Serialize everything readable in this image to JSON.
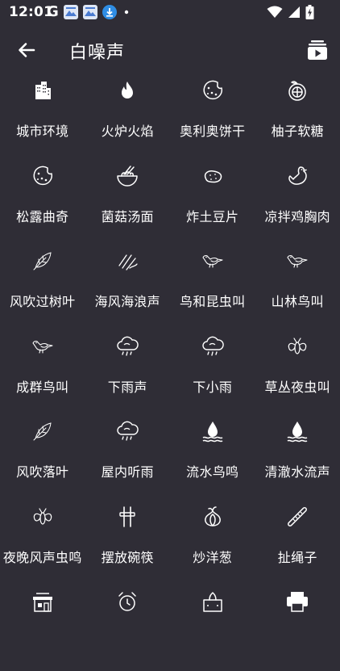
{
  "status_bar": {
    "time": "12:01",
    "g_label": "G",
    "icons": [
      "google-icon",
      "app-notification-icon",
      "app-notification-icon",
      "download-icon",
      "dot-icon",
      "wifi-icon",
      "signal-icon",
      "battery-charging-icon"
    ]
  },
  "header": {
    "title": "白噪声",
    "back_icon": "arrow-left-icon",
    "playlist_icon": "playlist-play-icon"
  },
  "sounds": [
    {
      "label": "城市环境",
      "icon": "city-icon"
    },
    {
      "label": "火炉火焰",
      "icon": "flame-icon"
    },
    {
      "label": "奥利奥饼干",
      "icon": "cookie-icon"
    },
    {
      "label": "柚子软糖",
      "icon": "grapefruit-icon"
    },
    {
      "label": "松露曲奇",
      "icon": "cookie-icon"
    },
    {
      "label": "菌菇汤面",
      "icon": "noodle-bowl-icon"
    },
    {
      "label": "炸土豆片",
      "icon": "potato-icon"
    },
    {
      "label": "凉拌鸡胸肉",
      "icon": "chicken-icon"
    },
    {
      "label": "风吹过树叶",
      "icon": "leaf-icon"
    },
    {
      "label": "海风海浪声",
      "icon": "wind-waves-icon"
    },
    {
      "label": "鸟和昆虫叫",
      "icon": "bird-icon"
    },
    {
      "label": "山林鸟叫",
      "icon": "bird-icon"
    },
    {
      "label": "成群鸟叫",
      "icon": "bird-icon"
    },
    {
      "label": "下雨声",
      "icon": "rain-cloud-icon"
    },
    {
      "label": "下小雨",
      "icon": "rain-cloud-icon"
    },
    {
      "label": "草丛夜虫叫",
      "icon": "insect-icon"
    },
    {
      "label": "风吹落叶",
      "icon": "leaf-icon"
    },
    {
      "label": "屋内听雨",
      "icon": "rain-cloud-icon"
    },
    {
      "label": "流水鸟鸣",
      "icon": "water-drop-icon"
    },
    {
      "label": "清澈水流声",
      "icon": "water-drop-icon"
    },
    {
      "label": "夜晚风声虫鸣",
      "icon": "insect-icon"
    },
    {
      "label": "摆放碗筷",
      "icon": "chopsticks-icon"
    },
    {
      "label": "炒洋葱",
      "icon": "onion-icon"
    },
    {
      "label": "扯绳子",
      "icon": "rope-icon"
    },
    {
      "label": "",
      "icon": "market-icon"
    },
    {
      "label": "",
      "icon": "alarm-clock-icon"
    },
    {
      "label": "",
      "icon": "tissue-box-icon"
    },
    {
      "label": "",
      "icon": "printer-icon"
    }
  ]
}
